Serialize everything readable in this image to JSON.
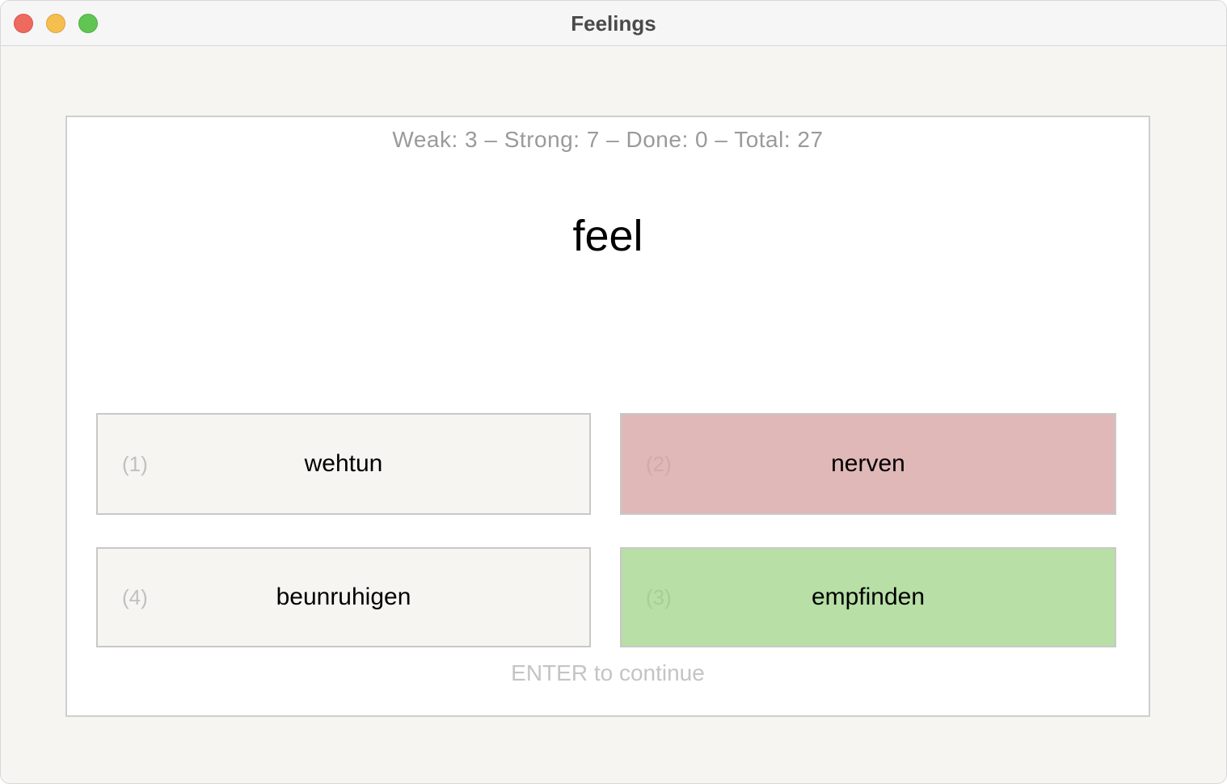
{
  "window": {
    "title": "Feelings"
  },
  "stats": "Weak: 3 – Strong: 7 – Done: 0 – Total: 27",
  "prompt": "feel",
  "options": [
    {
      "number": "(1)",
      "word": "wehtun",
      "state": "neutral",
      "color": "#f6f5f2"
    },
    {
      "number": "(2)",
      "word": "nerven",
      "state": "wrong",
      "color": "#e0b8b8"
    },
    {
      "number": "(4)",
      "word": "beunruhigen",
      "state": "neutral",
      "color": "#f6f5f2"
    },
    {
      "number": "(3)",
      "word": "empfinden",
      "state": "correct",
      "color": "#b7dfa6"
    }
  ],
  "hint": "ENTER to continue"
}
